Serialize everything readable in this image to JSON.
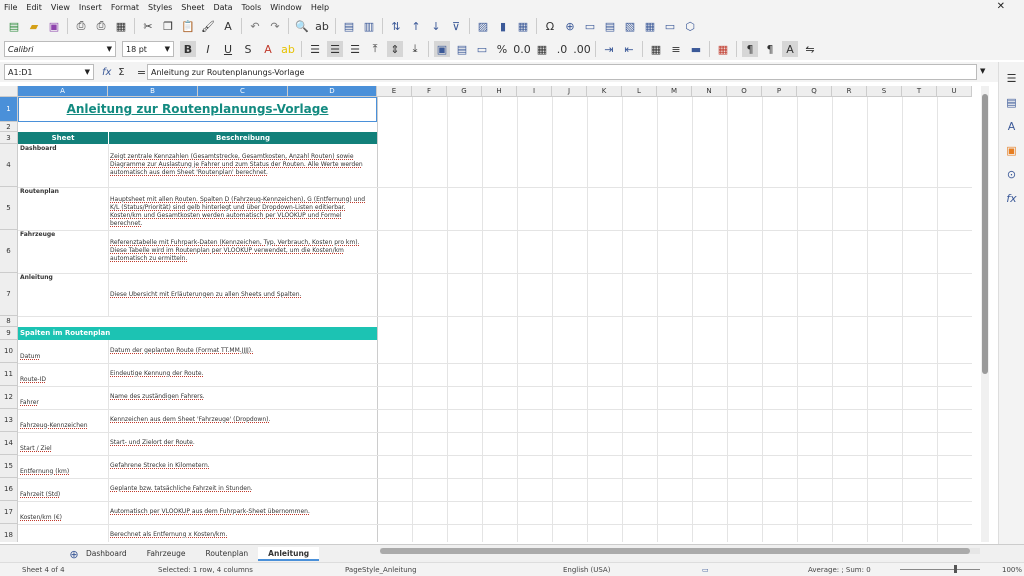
{
  "menu": [
    "File",
    "Edit",
    "View",
    "Insert",
    "Format",
    "Styles",
    "Sheet",
    "Data",
    "Tools",
    "Window",
    "Help"
  ],
  "font": {
    "name": "Calibri",
    "size": "18 pt"
  },
  "namebox": "A1:D1",
  "formula": "Anleitung zur Routenplanungs-Vorlage",
  "columns": [
    "A",
    "B",
    "C",
    "D",
    "E",
    "F",
    "G",
    "H",
    "I",
    "J",
    "K",
    "L",
    "M",
    "N",
    "O",
    "P",
    "Q",
    "R",
    "S",
    "T",
    "U"
  ],
  "rows": [
    "1",
    "2",
    "3",
    "4",
    "5",
    "6",
    "7",
    "8",
    "9",
    "10",
    "11",
    "12",
    "13",
    "14",
    "15",
    "16",
    "17",
    "18"
  ],
  "sheet": {
    "title": "Anleitung zur Routenplanungs-Vorlage",
    "header_sheet": "Sheet",
    "header_desc": "Beschreibung",
    "entries": [
      {
        "name": "Dashboard",
        "desc": "Zeigt zentrale Kennzahlen (Gesamtstrecke, Gesamtkosten, Anzahl Routen) sowie Diagramme zur Auslastung je Fahrer und zum Status der Routen. Alle Werte werden automatisch aus dem Sheet 'Routenplan' berechnet."
      },
      {
        "name": "Routenplan",
        "desc": "Hauptsheet mit allen Routen. Spalten D (Fahrzeug-Kennzeichen), G (Entfernung) und K/L (Status/Priorität) sind gelb hinterlegt und über Dropdown-Listen editierbar. Kosten/km und Gesamtkosten werden automatisch per VLOOKUP und Formel berechnet."
      },
      {
        "name": "Fahrzeuge",
        "desc": "Referenztabelle mit Fuhrpark-Daten (Kennzeichen, Typ, Verbrauch, Kosten pro km). Diese Tabelle wird im Routenplan per VLOOKUP verwendet, um die Kosten/km automatisch zu ermitteln."
      },
      {
        "name": "Anleitung",
        "desc": "Diese Übersicht mit Erläuterungen zu allen Sheets und Spalten."
      }
    ],
    "section": "Spalten im Routenplan",
    "columns_info": [
      {
        "name": "Datum",
        "desc": "Datum der geplanten Route (Format TT.MM.JJJJ)."
      },
      {
        "name": "Route-ID",
        "desc": "Eindeutige Kennung der Route."
      },
      {
        "name": "Fahrer",
        "desc": "Name des zuständigen Fahrers."
      },
      {
        "name": "Fahrzeug-Kennzeichen",
        "desc": "Kennzeichen aus dem Sheet 'Fahrzeuge' (Dropdown)."
      },
      {
        "name": "Start / Ziel",
        "desc": "Start- und Zielort der Route."
      },
      {
        "name": "Entfernung (km)",
        "desc": "Gefahrene Strecke in Kilometern."
      },
      {
        "name": "Fahrzeit (Std)",
        "desc": "Geplante bzw. tatsächliche Fahrzeit in Stunden."
      },
      {
        "name": "Kosten/km (€)",
        "desc": "Automatisch per VLOOKUP aus dem Fuhrpark-Sheet übernommen."
      },
      {
        "name": "",
        "desc": "Berechnet als Entfernung x Kosten/km."
      }
    ]
  },
  "tabs": [
    "Dashboard",
    "Fahrzeuge",
    "Routenplan",
    "Anleitung"
  ],
  "status": {
    "sheet": "Sheet 4 of 4",
    "selected": "Selected: 1 row, 4 columns",
    "pagestyle": "PageStyle_Anleitung",
    "lang": "English (USA)",
    "sum": "Average: ; Sum: 0",
    "zoom": "100%"
  }
}
